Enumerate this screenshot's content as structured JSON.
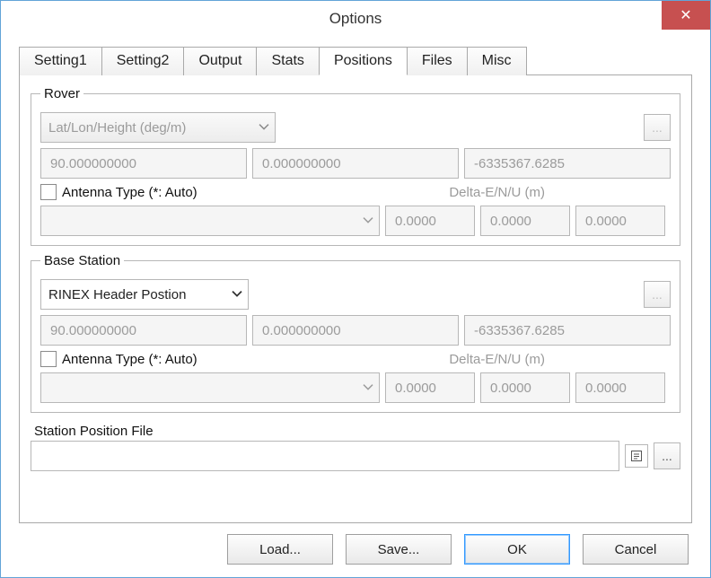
{
  "window": {
    "title": "Options",
    "close_symbol": "✕"
  },
  "tabs": [
    {
      "label": "Setting1"
    },
    {
      "label": "Setting2"
    },
    {
      "label": "Output"
    },
    {
      "label": "Stats"
    },
    {
      "label": "Positions"
    },
    {
      "label": "Files"
    },
    {
      "label": "Misc"
    }
  ],
  "active_tab": "Positions",
  "rover": {
    "legend": "Rover",
    "postype": "Lat/Lon/Height (deg/m)",
    "more": "...",
    "coords": {
      "a": "90.000000000",
      "b": "0.000000000",
      "c": "-6335367.6285"
    },
    "antenna_label": "Antenna Type (*: Auto)",
    "delta_label": "Delta-E/N/U (m)",
    "antenna_value": "",
    "delta": {
      "e": "0.0000",
      "n": "0.0000",
      "u": "0.0000"
    }
  },
  "base": {
    "legend": "Base Station",
    "postype": "RINEX Header Postion",
    "more": "...",
    "coords": {
      "a": "90.000000000",
      "b": "0.000000000",
      "c": "-6335367.6285"
    },
    "antenna_label": "Antenna Type (*: Auto)",
    "delta_label": "Delta-E/N/U (m)",
    "antenna_value": "",
    "delta": {
      "e": "0.0000",
      "n": "0.0000",
      "u": "0.0000"
    }
  },
  "station_file": {
    "label": "Station Position File",
    "value": "",
    "more": "..."
  },
  "buttons": {
    "load": "Load...",
    "save": "Save...",
    "ok": "OK",
    "cancel": "Cancel"
  }
}
